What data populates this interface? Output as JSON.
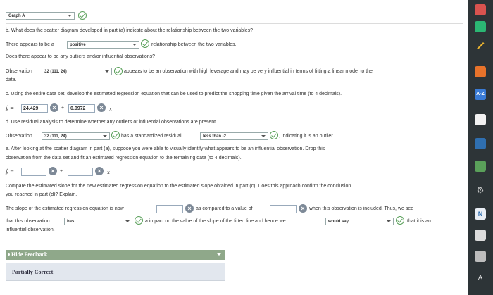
{
  "header": {
    "graph_select": "Graph A"
  },
  "part_b": {
    "question": "b. What does the scatter diagram developed in part (a) indicate about the relationship between the two variables?",
    "line1_pre": "There appears to be a",
    "relationship_select": "positive",
    "line1_post": "relationship between the two variables.",
    "line2": "Does there appear to be any outliers and/or influential observations?",
    "obs_label": "Observation",
    "obs_select": "32 (111, 24)",
    "obs_text": "appears to be an observation with high leverage and may be very influential in terms of fitting a linear model to the",
    "obs_text2": "data."
  },
  "part_c": {
    "question": "c. Using the entire data set, develop the estimated regression equation that can be used to predict the shopping time given the arrival time (to 4 decimals).",
    "yhat": "ŷ =",
    "intercept": "24.429",
    "plus": "+",
    "slope": "0.0972",
    "x": "x"
  },
  "part_d": {
    "question": "d. Use residual analysis to determine whether any outliers or influential observations are present.",
    "obs_label": "Observation",
    "obs_select": "32 (111, 24)",
    "mid": "has a standardized residual",
    "resid_select": "less than -2",
    "post": ", indicating it is an outlier."
  },
  "part_e": {
    "question1": "e. After looking at the scatter diagram in part (a), suppose you were able to visually identify what appears to be an influential observation. Drop this",
    "question2": "observation from the data set and fit an estimated regression equation to the remaining data (to 4 decimals).",
    "yhat": "ŷ =",
    "plus": "+",
    "x": "x",
    "intercept": "",
    "slope": "",
    "compare1": "Compare the estimated slope for the new estimated regression equation to the estimated slope obtained in part (c). Does this approach confirm the conclusion",
    "compare2": "you reached in part (d)? Explain.",
    "s1a": "The slope of the estimated regression equation is now",
    "s1b": "as compared to a value of",
    "s1c": "when this observation is included. Thus, we see",
    "new_slope": "",
    "old_slope": "",
    "s2a": "that this observation",
    "has_select": "has",
    "s2b": "a impact on the value of the slope of the fitted line and hence we",
    "would_select": "would say",
    "s2c": "that it is an",
    "s3": "influential observation."
  },
  "feedback": {
    "toggle_label": "Hide Feedback",
    "result": "Partially Correct"
  },
  "dock_icons": [
    "red-app-icon",
    "green-app-icon",
    "pen-icon",
    "rss-icon",
    "az-icon",
    "browser-icon",
    "blue-app-icon",
    "image-icon",
    "settings-icon",
    "n-app-icon",
    "note-icon",
    "grid-icon",
    "text-size-icon"
  ]
}
